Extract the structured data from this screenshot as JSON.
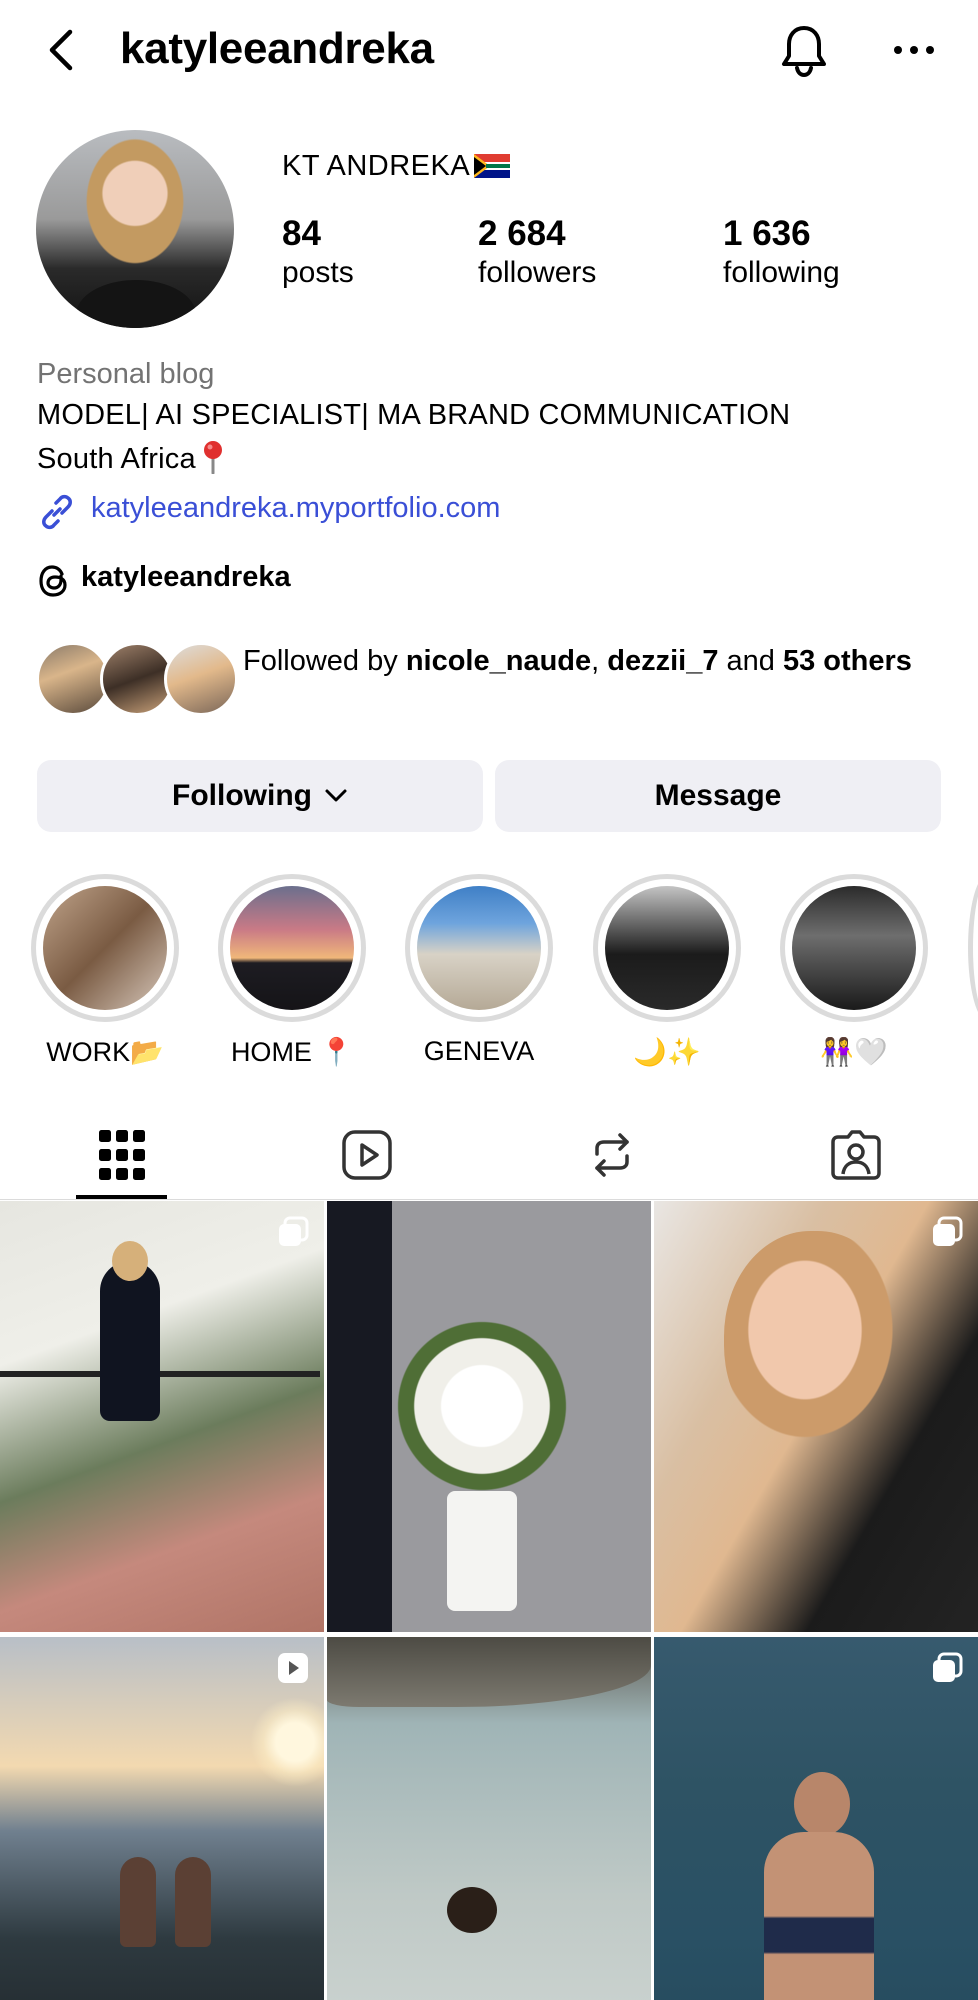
{
  "header": {
    "username": "katyleeandreka"
  },
  "profile": {
    "display_name": "KT ANDREKA",
    "stats": [
      {
        "value": "84",
        "label": "posts"
      },
      {
        "value": "2 684",
        "label": "followers"
      },
      {
        "value": "1 636",
        "label": "following"
      }
    ],
    "category": "Personal blog",
    "bio_line_1": "MODEL| AI SPECIALIST| MA BRAND COMMUNICATION",
    "bio_line_2": "South Africa",
    "link": "katyleeandreka.myportfolio.com",
    "threads_handle": "katyleeandreka"
  },
  "followed_by": {
    "prefix": "Followed by ",
    "user_1": "nicole_naude",
    "separator": ", ",
    "user_2": "dezzii_7",
    "and_text": " and ",
    "others": "53 others"
  },
  "actions": {
    "following_label": "Following",
    "message_label": "Message"
  },
  "highlights": [
    {
      "label": "WORK📂"
    },
    {
      "label": "HOME 📍"
    },
    {
      "label": "GENEVA"
    },
    {
      "label": "🌙✨"
    },
    {
      "label": "👭🤍"
    }
  ],
  "tabs": [
    {
      "icon": "grid-icon",
      "active": true
    },
    {
      "icon": "reels-icon",
      "active": false
    },
    {
      "icon": "reposts-icon",
      "active": false
    },
    {
      "icon": "tagged-icon",
      "active": false
    }
  ],
  "grid_posts": [
    {
      "badge": "carousel-icon"
    },
    {
      "badge": null
    },
    {
      "badge": "carousel-icon"
    },
    {
      "badge": "reel-icon"
    },
    {
      "badge": null
    },
    {
      "badge": "carousel-icon"
    }
  ],
  "colors": {
    "link": "#3a4fd6",
    "button_bg": "#efeff4",
    "secondary_text": "#737373",
    "highlight_ring": "#dbdbdb"
  }
}
